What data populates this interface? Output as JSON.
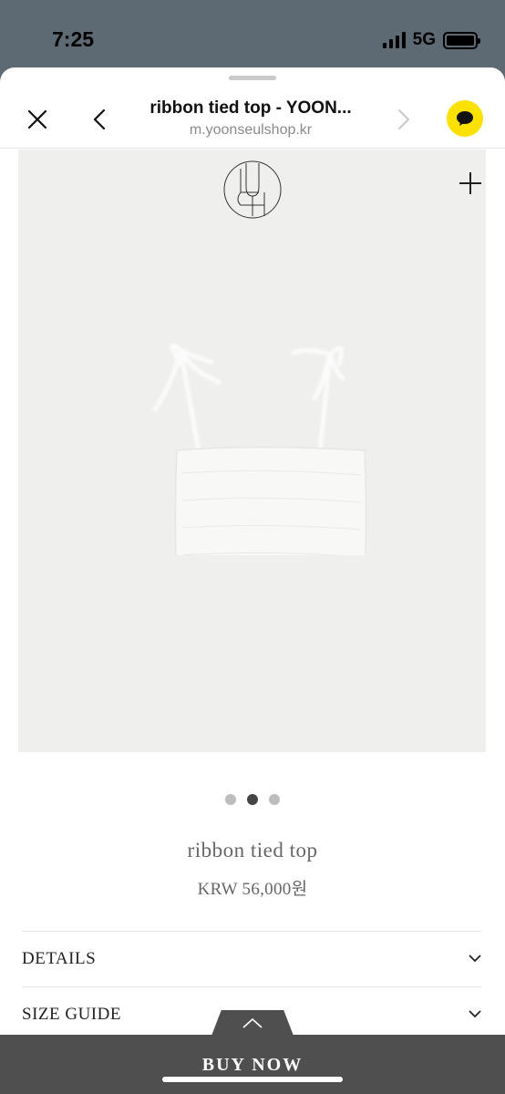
{
  "status": {
    "time": "7:25",
    "network": "5G",
    "battery_level": 1.0
  },
  "nav": {
    "title": "ribbon tied top - YOON...",
    "url": "m.yoonseulshop.kr"
  },
  "icons": {
    "close": "close-icon",
    "back": "chevron-left-icon",
    "forward": "chevron-right-icon",
    "chat": "kakaotalk-chat-icon",
    "zoom": "plus-icon",
    "expand": "chevron-down-icon",
    "buy_tab": "chevron-up-icon"
  },
  "carousel": {
    "count": 3,
    "active_index": 1
  },
  "product": {
    "name": "ribbon tied top",
    "price": "KRW 56,000원"
  },
  "accordion": [
    {
      "label": "DETAILS"
    },
    {
      "label": "SIZE GUIDE"
    }
  ],
  "buy": {
    "label": "BUY NOW"
  },
  "colors": {
    "kakao_yellow": "#fae100",
    "buy_bar": "#4f4f4f",
    "image_bg": "#efefed"
  }
}
